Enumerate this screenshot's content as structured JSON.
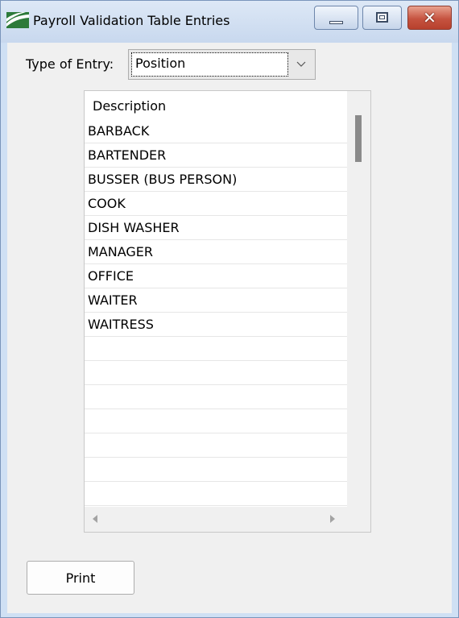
{
  "window": {
    "title": "Payroll Validation Table Entries",
    "app_icon": "payroll-app-icon",
    "controls": {
      "minimize_icon": "minimize-icon",
      "maximize_icon": "maximize-icon",
      "close_icon": "close-icon",
      "close_color": "#c65340"
    }
  },
  "filter": {
    "label": "Type of Entry:",
    "selected_value": "Position",
    "dropdown_icon": "chevron-down-icon"
  },
  "list": {
    "header": "Description",
    "rows": [
      "BARBACK",
      "BARTENDER",
      "BUSSER (BUS PERSON)",
      "COOK",
      "DISH WASHER",
      "MANAGER",
      "OFFICE",
      "WAITER",
      "WAITRESS",
      "",
      "",
      "",
      "",
      "",
      "",
      ""
    ]
  },
  "actions": {
    "print_label": "Print"
  }
}
